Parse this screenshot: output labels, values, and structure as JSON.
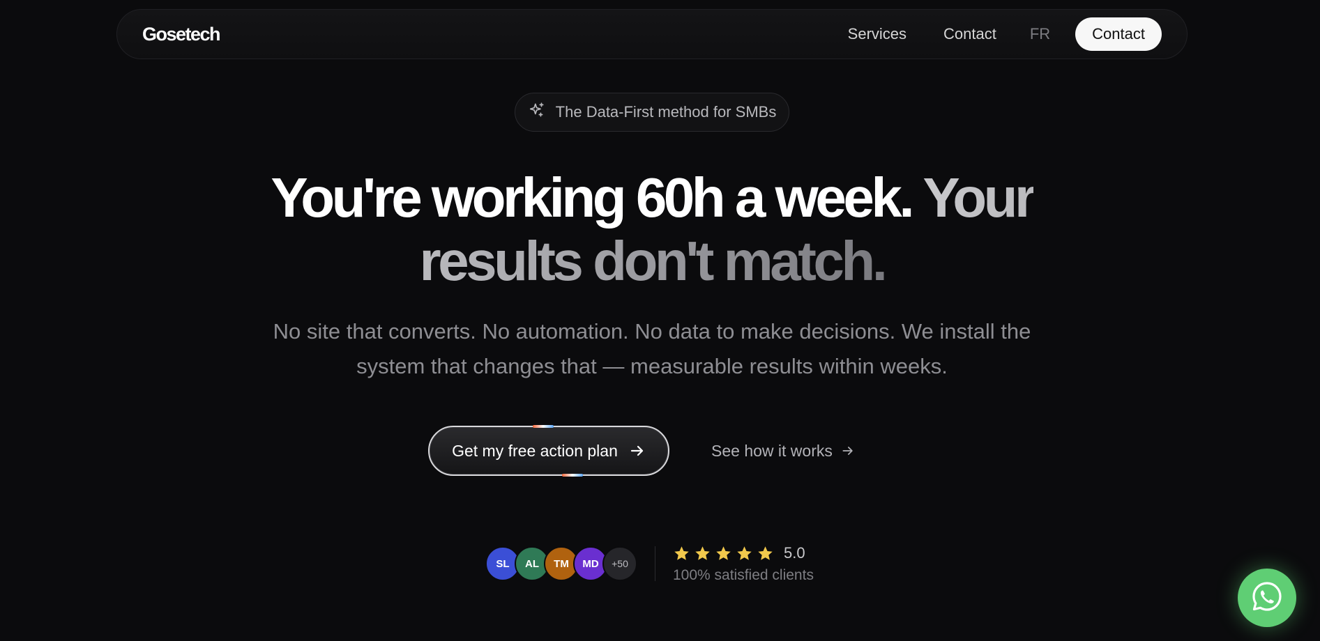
{
  "nav": {
    "logo": "Gosetech",
    "links": [
      "Services",
      "Contact"
    ],
    "lang": "FR",
    "cta": "Contact"
  },
  "badge": {
    "text": "The Data-First method for SMBs",
    "icon": "sparkle-icon"
  },
  "hero": {
    "headline_main": "You're working 60h a week.",
    "headline_muted": "Your results don't match.",
    "subtitle": "No site that converts. No automation. No data to make decisions. We install the system that changes that — measurable results within weeks."
  },
  "ctas": {
    "primary": "Get my free action plan",
    "secondary": "See how it works"
  },
  "social_proof": {
    "avatars": [
      {
        "initials": "SL",
        "color": "#3b4fd6"
      },
      {
        "initials": "AL",
        "color": "#2f7a56"
      },
      {
        "initials": "TM",
        "color": "#b0620f"
      },
      {
        "initials": "MD",
        "color": "#6a2fd0"
      },
      {
        "initials": "+50",
        "color": "#26262a"
      }
    ],
    "stars": 5,
    "score": "5.0",
    "caption": "100% satisfied clients"
  },
  "whatsapp": {
    "icon": "whatsapp-icon"
  },
  "colors": {
    "background": "#0b0b0d",
    "star": "#f2c94c",
    "whatsapp": "#5fce74"
  }
}
